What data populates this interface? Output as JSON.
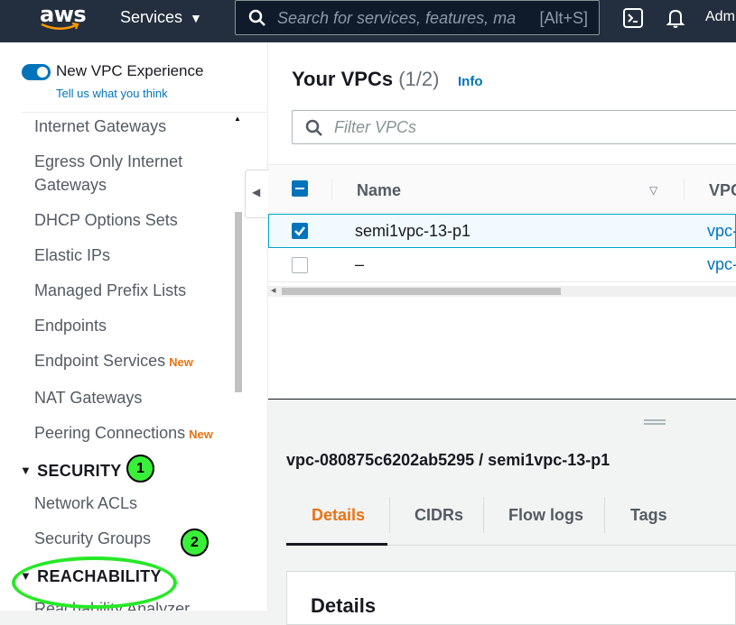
{
  "topnav": {
    "logo_text": "aws",
    "services_label": "Services",
    "search_placeholder": "Search for services, features, ma",
    "search_shortcut": "[Alt+S]",
    "account_label": "Adm"
  },
  "sidebar": {
    "toggle_label": "New VPC Experience",
    "feedback_link": "Tell us what you think",
    "new_badge": "New",
    "items": [
      {
        "label": "Internet Gateways"
      },
      {
        "label": "Egress Only Internet"
      },
      {
        "label": "Gateways"
      },
      {
        "label": "DHCP Options Sets"
      },
      {
        "label": "Elastic IPs"
      },
      {
        "label": "Managed Prefix Lists"
      },
      {
        "label": "Endpoints"
      },
      {
        "label": "Endpoint Services"
      },
      {
        "label": "NAT Gateways"
      },
      {
        "label": "Peering Connections"
      }
    ],
    "security_section": "SECURITY",
    "security_items": [
      {
        "label": "Network ACLs"
      },
      {
        "label": "Security Groups"
      }
    ],
    "reachability_section": "REACHABILITY",
    "reachability_items": [
      {
        "label": "Reachability Analyzer"
      }
    ]
  },
  "annotations": {
    "marker_1": "1",
    "marker_2": "2"
  },
  "vpcs": {
    "title": "Your VPCs",
    "count": "(1/2)",
    "info_link": "Info",
    "filter_placeholder": "Filter VPCs",
    "columns": {
      "name": "Name",
      "vpc_id": "VPC"
    },
    "rows": [
      {
        "name": "semi1vpc-13-p1",
        "vpc_id": "vpc-",
        "selected": true
      },
      {
        "name": "–",
        "vpc_id": "vpc-",
        "selected": false
      }
    ]
  },
  "details": {
    "title": "vpc-080875c6202ab5295 / semi1vpc-13-p1",
    "tabs": [
      {
        "label": "Details",
        "active": true
      },
      {
        "label": "CIDRs"
      },
      {
        "label": "Flow logs"
      },
      {
        "label": "Tags"
      }
    ],
    "section_title": "Details"
  },
  "colors": {
    "nav_bg": "#232f3e",
    "link": "#0073bb",
    "accent_orange": "#ec7211",
    "annotation_green": "#39f039"
  }
}
